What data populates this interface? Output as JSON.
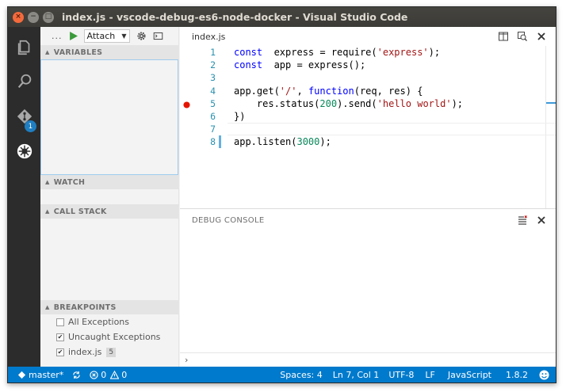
{
  "window": {
    "title": "index.js - vscode-debug-es6-node-docker - Visual Studio Code",
    "buttons": {
      "close": "×",
      "minimize": "−",
      "maximize": "□"
    }
  },
  "activitybar": {
    "items": [
      {
        "icon": "files-icon"
      },
      {
        "icon": "search-icon"
      },
      {
        "icon": "git-icon",
        "badge": "1"
      },
      {
        "icon": "debug-icon"
      }
    ]
  },
  "debug_toolbar": {
    "more_label": "...",
    "config_selected": "Attach",
    "icons": [
      "start-debug-icon",
      "gear-icon",
      "console-icon"
    ]
  },
  "sidebar": {
    "sections": {
      "variables": "VARIABLES",
      "watch": "WATCH",
      "call_stack": "CALL STACK",
      "breakpoints": "BREAKPOINTS"
    },
    "breakpoints": [
      {
        "label": "All Exceptions",
        "checked": false
      },
      {
        "label": "Uncaught Exceptions",
        "checked": true
      },
      {
        "label": "index.js",
        "checked": true,
        "count": "5"
      }
    ]
  },
  "editor": {
    "tab": "index.js",
    "lines": [
      {
        "n": "1",
        "tokens": [
          [
            "kw",
            "const"
          ],
          [
            "",
            "  express = require("
          ],
          [
            "str",
            "'express'"
          ],
          [
            "",
            ");"
          ]
        ]
      },
      {
        "n": "2",
        "tokens": [
          [
            "kw",
            "const"
          ],
          [
            "",
            "  app = express();"
          ]
        ]
      },
      {
        "n": "3",
        "tokens": []
      },
      {
        "n": "4",
        "tokens": [
          [
            "",
            "app.get("
          ],
          [
            "str",
            "'/'"
          ],
          [
            "",
            ", "
          ],
          [
            "kw",
            "function"
          ],
          [
            "",
            "(req, res) {"
          ]
        ]
      },
      {
        "n": "5",
        "tokens": [
          [
            "",
            "    res.status("
          ],
          [
            "num",
            "200"
          ],
          [
            "",
            ").send("
          ],
          [
            "str",
            "'hello world'"
          ],
          [
            "",
            ");"
          ]
        ],
        "breakpoint": true
      },
      {
        "n": "6",
        "tokens": [
          [
            "",
            "})"
          ]
        ]
      },
      {
        "n": "7",
        "tokens": []
      },
      {
        "n": "8",
        "tokens": [
          [
            "",
            "app.listen("
          ],
          [
            "num",
            "3000"
          ],
          [
            "",
            ");"
          ]
        ]
      }
    ],
    "colors": {
      "keyword": "#0000ff",
      "string": "#a31515",
      "number": "#09885a",
      "breakpoint": "#e51400"
    }
  },
  "panel": {
    "title": "DEBUG CONSOLE",
    "prompt": "›"
  },
  "statusbar": {
    "branch": "master*",
    "errors": "0",
    "warnings": "0",
    "spaces": "Spaces: 4",
    "position": "Ln 7, Col 1",
    "encoding": "UTF-8",
    "eol": "LF",
    "language": "JavaScript",
    "version": "1.8.2",
    "colors": {
      "background": "#007acc"
    }
  }
}
